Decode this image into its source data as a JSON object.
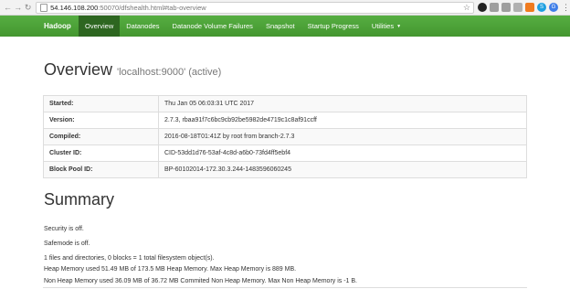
{
  "browser": {
    "url_host": "54.146.108.200",
    "url_rest": ":50070/dfshealth.html#tab-overview",
    "extension_icons": [
      {
        "name": "dark-circle-extension-icon",
        "color": "#222222",
        "glyph": ""
      },
      {
        "name": "gray-square-extension-icon",
        "color": "#9e9e9e",
        "glyph": ""
      },
      {
        "name": "gray-square-extension-icon-2",
        "color": "#9e9e9e",
        "glyph": ""
      },
      {
        "name": "gray-square-extension-icon-3",
        "color": "#b0b0b0",
        "glyph": ""
      },
      {
        "name": "rss-icon",
        "color": "#f07b1f",
        "glyph": ""
      },
      {
        "name": "skype-icon",
        "color": "#1d9fe0",
        "glyph": "S"
      },
      {
        "name": "google-icon",
        "color": "#3f7ee8",
        "glyph": "G"
      }
    ]
  },
  "navbar": {
    "brand": "Hadoop",
    "items": [
      {
        "label": "Overview",
        "active": true
      },
      {
        "label": "Datanodes",
        "active": false
      },
      {
        "label": "Datanode Volume Failures",
        "active": false
      },
      {
        "label": "Snapshot",
        "active": false
      },
      {
        "label": "Startup Progress",
        "active": false
      },
      {
        "label": "Utilities",
        "active": false
      }
    ]
  },
  "overview": {
    "title": "Overview",
    "subtitle": "'localhost:9000' (active)",
    "rows": [
      {
        "key": "Started:",
        "value": "Thu Jan 05 06:03:31 UTC 2017"
      },
      {
        "key": "Version:",
        "value": "2.7.3, rbaa91f7c6bc9cb92be5982de4719c1c8af91ccff"
      },
      {
        "key": "Compiled:",
        "value": "2016-08-18T01:41Z by root from branch-2.7.3"
      },
      {
        "key": "Cluster ID:",
        "value": "CID-53dd1d76-53af-4c8d-a6b0-73fd4ff5ebf4"
      },
      {
        "key": "Block Pool ID:",
        "value": "BP-60102014-172.30.3.244-1483596060245"
      }
    ]
  },
  "summary": {
    "title": "Summary",
    "lines": [
      "Security is off.",
      "Safemode is off.",
      "1 files and directories, 0 blocks = 1 total filesystem object(s).",
      "Heap Memory used 51.49 MB of 173.5 MB Heap Memory. Max Heap Memory is 889 MB.",
      "Non Heap Memory used 36.09 MB of 36.72 MB Commited Non Heap Memory. Max Non Heap Memory is -1 B."
    ]
  }
}
